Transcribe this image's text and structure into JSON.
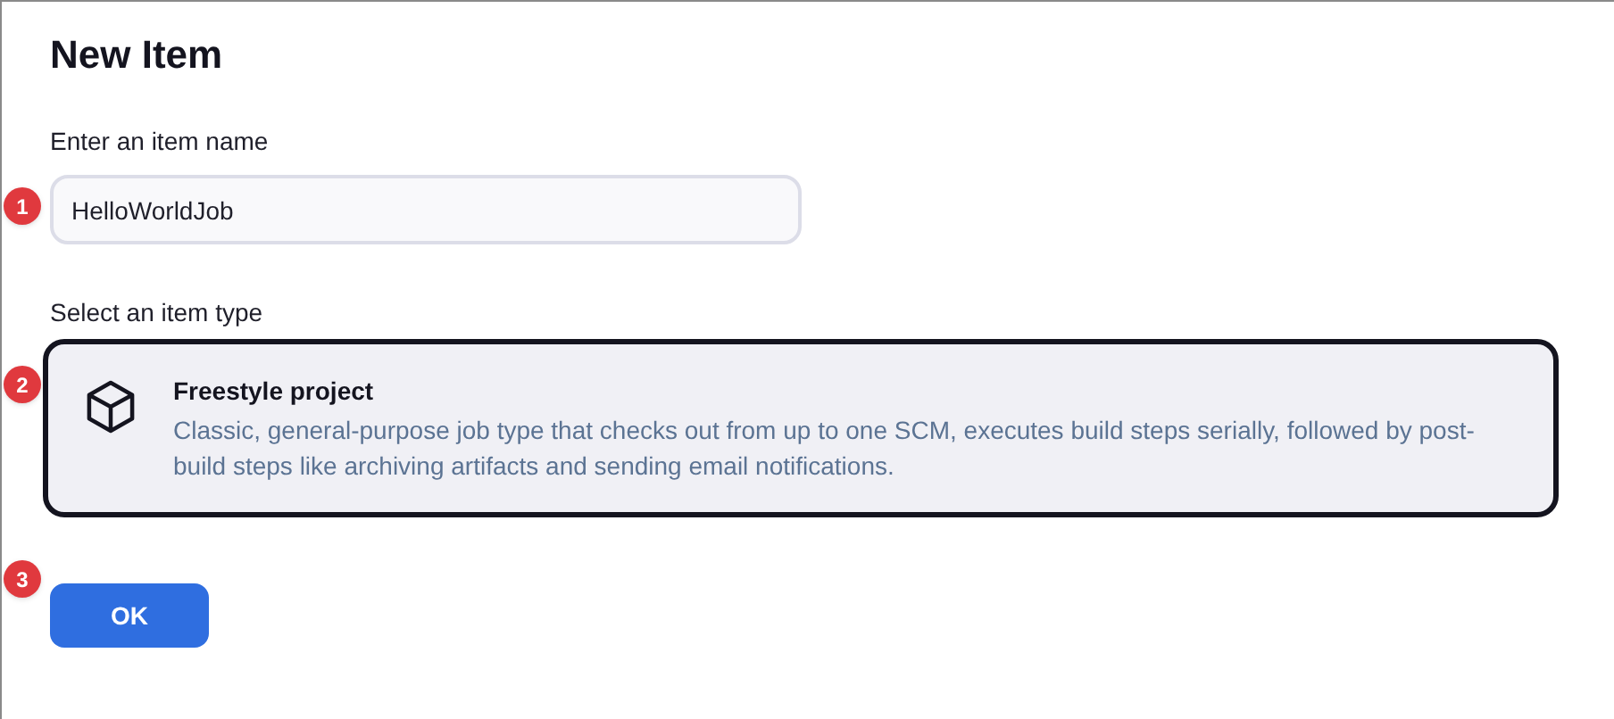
{
  "title": "New Item",
  "name_field": {
    "label": "Enter an item name",
    "value": "HelloWorldJob"
  },
  "type_section": {
    "label": "Select an item type",
    "items": [
      {
        "title": "Freestyle project",
        "description": "Classic, general-purpose job type that checks out from up to one SCM, executes build steps serially, followed by post-build steps like archiving artifacts and sending email notifications.",
        "selected": true
      }
    ]
  },
  "ok_button": "OK",
  "callouts": [
    "1",
    "2",
    "3"
  ]
}
